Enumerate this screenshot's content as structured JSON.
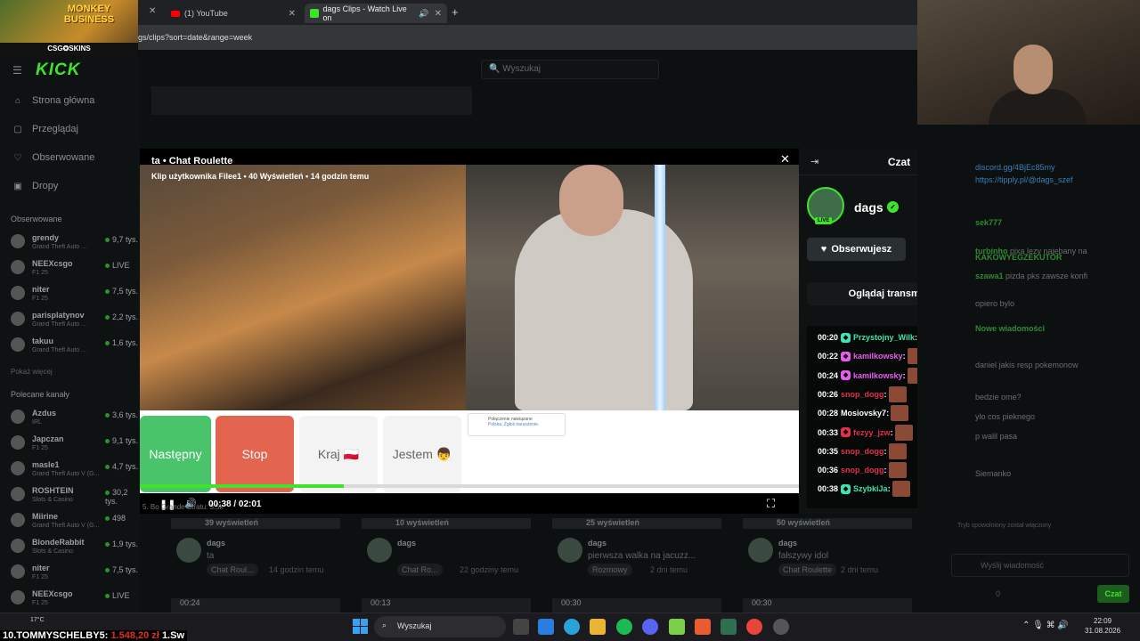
{
  "browser": {
    "tabs": [
      {
        "label": "(1) YouTube"
      },
      {
        "label": "dags Clips - Watch Live on"
      }
    ],
    "url": "gs/clips?sort=date&range=week"
  },
  "promo": {
    "title": "MONKEY BUSINESS",
    "sub": "CSG✪SKINS"
  },
  "kick": {
    "logo": "KICK",
    "search_placeholder": "Wyszukaj",
    "nav": [
      "Strona główna",
      "Przeglądaj",
      "Obserwowane",
      "Dropy"
    ],
    "followed_label": "Obserwowane",
    "followed": [
      {
        "name": "grendy",
        "game": "Grand Theft Auto ...",
        "viewers": "9,7 tys."
      },
      {
        "name": "NEEXcsgo",
        "game": "F1 25",
        "viewers": "LIVE"
      },
      {
        "name": "niter",
        "game": "F1 25",
        "viewers": "7,5 tys."
      },
      {
        "name": "parisplatynov",
        "game": "Grand Theft Auto ...",
        "viewers": "2,2 tys."
      },
      {
        "name": "takuu",
        "game": "Grand Theft Auto ...",
        "viewers": "1,6 tys."
      }
    ],
    "show_more": "Pokaż więcej",
    "recommended_label": "Polecane kanały",
    "recommended": [
      {
        "name": "Azdus",
        "game": "IRL",
        "viewers": "3,6 tys."
      },
      {
        "name": "Japczan",
        "game": "F1 25",
        "viewers": "9,1 tys."
      },
      {
        "name": "masle1",
        "game": "Grand Theft Auto V (G...",
        "viewers": "4,7 tys."
      },
      {
        "name": "ROSHTEIN",
        "game": "Slots & Casino",
        "viewers": "30,2 tys."
      },
      {
        "name": "Miirine",
        "game": "Grand Theft Auto V (G...",
        "viewers": "498"
      },
      {
        "name": "BlondeRabbit",
        "game": "Slots & Casino",
        "viewers": "1,9 tys."
      },
      {
        "name": "niter",
        "game": "F1 25",
        "viewers": "7,5 tys."
      },
      {
        "name": "NEEXcsgo",
        "game": "F1 25",
        "viewers": "LIVE"
      }
    ]
  },
  "clip": {
    "title": "ta • Chat Roulette",
    "meta": "Klip użytkownika Filee1 • 40 Wyświetleń • 14 godzin temu",
    "buttons": {
      "next": "Następny",
      "stop": "Stop",
      "country": "Kraj 🇵🇱",
      "me": "Jestem 👦"
    },
    "popup_text": "Połączenie nawiązane",
    "popup_sub": "Polska. Zgłoś naruszenie.",
    "time": "00:38 / 02:01",
    "progress": 0.31,
    "bottom_ghost": "5. Bo Grande  Stratu: 3.5k"
  },
  "chat": {
    "title": "Czat",
    "streamer": "dags",
    "live": "LIVE",
    "follow_label": "Obserwujesz",
    "watch_label": "Oglądaj transmisję",
    "messages": [
      {
        "time": "00:20",
        "user": "Przystojny_Wilk",
        "color": "#3fe3b0",
        "badge": "#3fe3b0"
      },
      {
        "time": "00:22",
        "user": "kamilkowsky",
        "color": "#e85cf0",
        "badge": "#e85cf0"
      },
      {
        "time": "00:24",
        "user": "kamilkowsky",
        "color": "#e85cf0",
        "badge": "#e85cf0"
      },
      {
        "time": "00:26",
        "user": "snop_dogg",
        "color": "#e0304a",
        "badge": ""
      },
      {
        "time": "00:28",
        "user": "Mosiovsky7",
        "color": "#ffffff",
        "badge": ""
      },
      {
        "time": "00:33",
        "user": "fezyy_jzw",
        "color": "#e0304a",
        "badge": "#e0304a"
      },
      {
        "time": "00:35",
        "user": "snop_dogg",
        "color": "#e0304a",
        "badge": ""
      },
      {
        "time": "00:36",
        "user": "snop_dogg",
        "color": "#e0304a",
        "badge": ""
      },
      {
        "time": "00:38",
        "user": "SzybkiJa",
        "color": "#3fe3b0",
        "badge": "#3fe3b0"
      }
    ]
  },
  "clips": [
    {
      "views": "39 wyświetleń",
      "channel": "dags",
      "title": "ta",
      "tag": "Chat Roul...",
      "ago": "14 godzin temu",
      "dur": "00:24"
    },
    {
      "views": "10 wyświetleń",
      "channel": "dags",
      "title": "",
      "tag": "Chat Ro...",
      "ago": "22 godziny temu",
      "dur": "00:13"
    },
    {
      "views": "25 wyświetleń",
      "channel": "dags",
      "title": "pierwsza walka na jacuzz...",
      "tag": "Rozmowy",
      "ago": "2 dni temu",
      "dur": "00:30"
    },
    {
      "views": "50 wyświetleń",
      "channel": "dags",
      "title": "fałszywy idol",
      "tag": "Chat Roulette",
      "ago": "2 dni temu",
      "dur": "00:30"
    }
  ],
  "side_chat": {
    "lines": [
      {
        "user": "sek777",
        "text": ""
      },
      {
        "user": "turbinho",
        "text": "pixa lezy najebany na"
      },
      {
        "user": "KAKOWYEGZEKUTOR",
        "text": ""
      },
      {
        "user": "szawa1",
        "text": "pizda pks zawsze konfi"
      },
      {
        "user": "",
        "text": "opiero bylo"
      },
      {
        "user": "Nowe wiadomości",
        "text": ""
      },
      {
        "user": "",
        "text": "daniel jakis resp pokemonow"
      },
      {
        "user": "",
        "text": "bedzie ome?"
      },
      {
        "user": "",
        "text": "ylo cos pieknego"
      },
      {
        "user": "",
        "text": "p walil pasa"
      },
      {
        "user": "",
        "text": "Siemanko"
      }
    ],
    "link": "discord.gg/4BjEc85my",
    "link2": "https://tipply.pl/@dags_szef",
    "input_placeholder": "Wyślij wiadomość",
    "send": "Czat",
    "slowmode": "Tryb spowolniony został włączony",
    "count": "0"
  },
  "taskbar": {
    "ticker_rank": "10.TOMMYSCHELBY5:",
    "ticker_amount": "1.548,20 zł",
    "ticker_next": "1.Sw",
    "weather": "17°C",
    "search": "Wyszukaj",
    "time": "22:09",
    "date": "31.08.2026"
  }
}
